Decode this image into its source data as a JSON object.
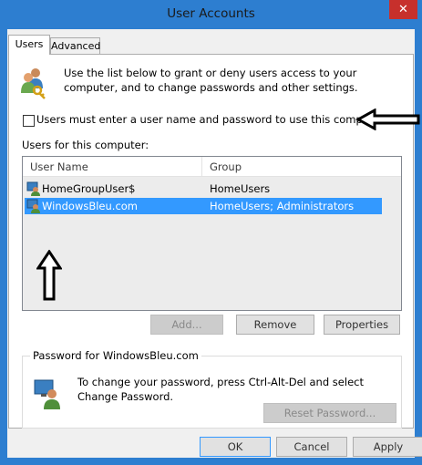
{
  "window": {
    "title": "User Accounts",
    "close_glyph": "✕"
  },
  "tabs": [
    {
      "label": "Users",
      "active": true
    },
    {
      "label": "Advanced",
      "active": false
    }
  ],
  "intro": {
    "text": "Use the list below to grant or deny users access to your computer, and to change passwords and other settings."
  },
  "checkbox": {
    "label": "Users must enter a user name and password to use this computer.",
    "checked": false
  },
  "users": {
    "label": "Users for this computer:",
    "columns": [
      "User Name",
      "Group"
    ],
    "rows": [
      {
        "name": "HomeGroupUser$",
        "group": "HomeUsers",
        "selected": false
      },
      {
        "name": "WindowsBleu.com",
        "group": "HomeUsers; Administrators",
        "selected": true
      }
    ]
  },
  "buttons": {
    "add": "Add...",
    "remove": "Remove",
    "properties": "Properties"
  },
  "password": {
    "group_title": "Password for WindowsBleu.com",
    "text": "To change your password, press Ctrl-Alt-Del and select Change Password.",
    "reset": "Reset Password..."
  },
  "footer": {
    "ok": "OK",
    "cancel": "Cancel",
    "apply": "Apply"
  },
  "colors": {
    "title_bar": "#2d7ed0",
    "close": "#c7302c",
    "selection": "#3399ff"
  }
}
